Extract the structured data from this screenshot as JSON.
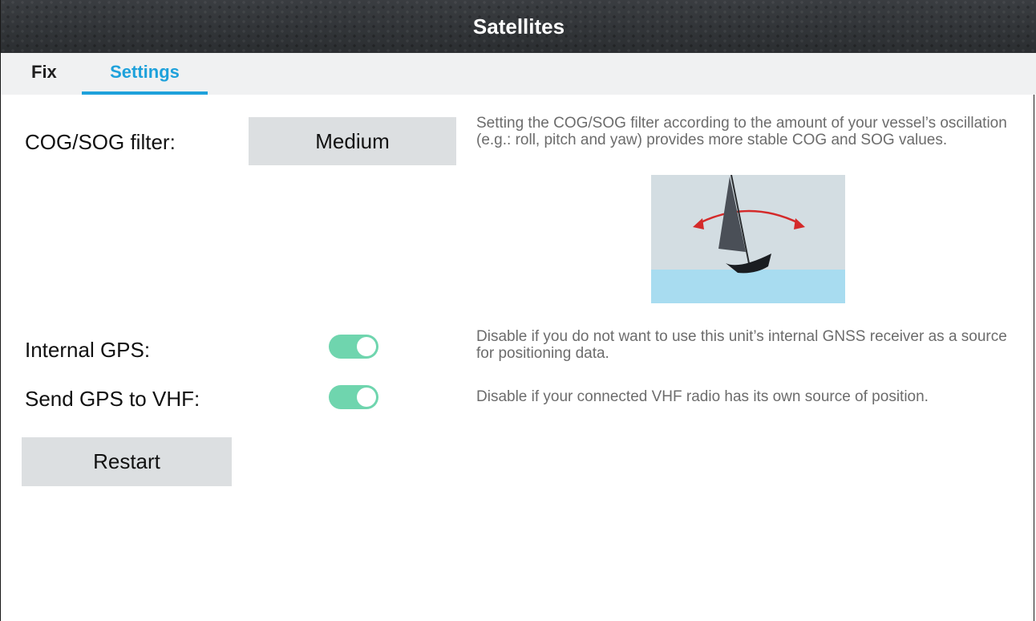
{
  "window": {
    "title": "Satellites"
  },
  "tabs": [
    {
      "label": "Fix",
      "active": false
    },
    {
      "label": "Settings",
      "active": true
    }
  ],
  "settings": {
    "cog_sog": {
      "label": "COG/SOG filter:",
      "value": "Medium",
      "description": "Setting the COG/SOG filter according to the amount of your vessel’s oscillation (e.g.: roll, pitch and yaw) provides more stable COG and SOG values."
    },
    "internal_gps": {
      "label": "Internal GPS:",
      "enabled": true,
      "description": "Disable if you do not want to use this unit’s internal GNSS receiver as a source for positioning data."
    },
    "send_gps_vhf": {
      "label": "Send GPS to VHF:",
      "enabled": true,
      "description": "Disable if your connected VHF radio has its own source of position."
    },
    "restart_label": "Restart"
  },
  "colors": {
    "accent": "#1ea1db",
    "toggle_on": "#6fd5ae",
    "button_bg": "#dcdfe1",
    "titlebar_bg": "#34373b",
    "arrow": "#d42a2a",
    "sky": "#d3dde2",
    "water": "#a8dcf0"
  },
  "icons": {
    "illustration": "boat-oscillation-illustration"
  }
}
